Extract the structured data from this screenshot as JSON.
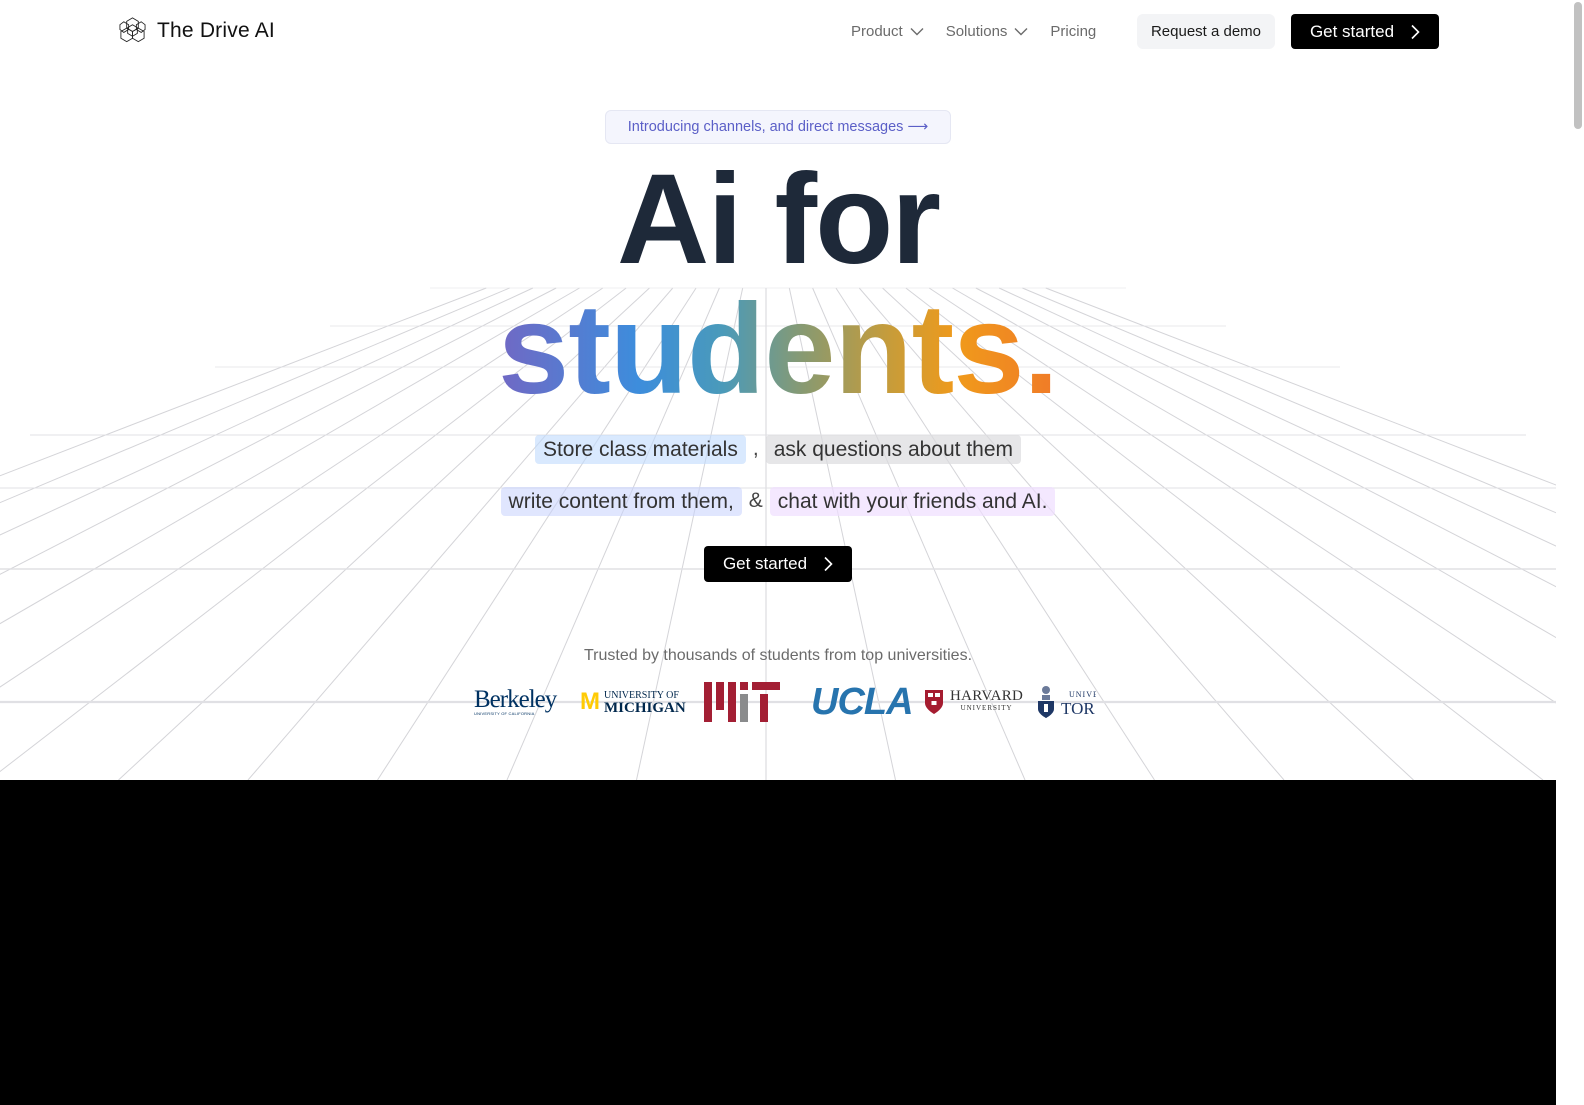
{
  "nav": {
    "brand": {
      "name": "The Drive AI",
      "icon": "hexagon-cluster-logo-icon"
    },
    "links": [
      {
        "label": "Product",
        "has_dropdown": true,
        "icon": "chevron-down-icon"
      },
      {
        "label": "Solutions",
        "has_dropdown": true,
        "icon": "chevron-down-icon"
      },
      {
        "label": "Pricing",
        "has_dropdown": false
      }
    ],
    "request_demo_label": "Request a demo",
    "get_started_label": "Get started",
    "get_started_icon": "chevron-right-icon"
  },
  "hero": {
    "announcement": "Introducing channels, and direct messages ⟶",
    "headline_line1": "Ai for",
    "headline_line2": "students.",
    "taglines": {
      "row1": [
        {
          "text": "Store class materials",
          "style": "blue"
        },
        {
          "separator": ","
        },
        {
          "text": "ask questions about them",
          "style": "gray"
        }
      ],
      "row2": [
        {
          "text": "write content from them,",
          "style": "indigo"
        },
        {
          "separator": "&"
        },
        {
          "text": "chat with your friends and AI.",
          "style": "purple"
        }
      ]
    },
    "cta_label": "Get started",
    "cta_icon": "chevron-right-icon",
    "trusted_text": "Trusted by thousands of students from top universities.",
    "logos": [
      {
        "name": "Berkeley",
        "subtitle": "UNIVERSITY OF CALIFORNIA"
      },
      {
        "name": "MICHIGAN",
        "subtitle": "UNIVERSITY OF"
      },
      {
        "name": "MIT"
      },
      {
        "name": "UCLA"
      },
      {
        "name": "HARVARD",
        "subtitle": "UNIVERSITY"
      },
      {
        "name": "TORONTO",
        "subtitle": "UNIVERSITY OF",
        "visible_name": "TOR",
        "visible_subtitle": "UNIVEI"
      }
    ]
  },
  "colors": {
    "headline": "#1e2939",
    "gradient_start": "#7168c4",
    "gradient_mid": "#3d8ddc",
    "gradient_end": "#f07a28",
    "accent_indigo": "#5b5fc7",
    "button_bg": "#000000",
    "dark_section": "#000000"
  }
}
